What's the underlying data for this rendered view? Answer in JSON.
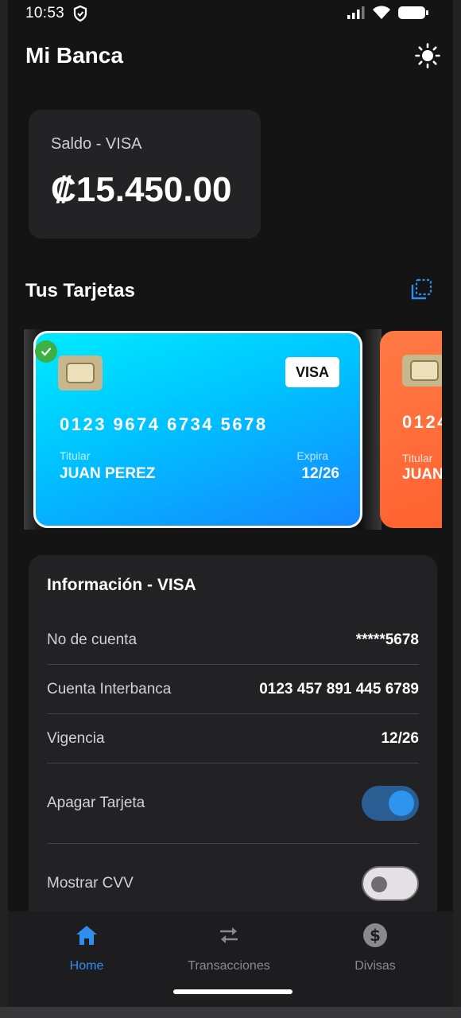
{
  "status_bar": {
    "time": "10:53"
  },
  "app_bar": {
    "title": "Mi Banca"
  },
  "balance": {
    "label": "Saldo - VISA",
    "amount": "₡15.450.00"
  },
  "cards_section": {
    "title": "Tus Tarjetas"
  },
  "cards": [
    {
      "brand": "VISA",
      "number": "0123 9674 6734 5678",
      "holder_label": "Titular",
      "holder": "JUAN PEREZ",
      "expiry_label": "Expira",
      "expiry": "12/26",
      "selected": true,
      "gradient": [
        "#00eaff",
        "#1585ff"
      ]
    },
    {
      "number": "0124",
      "holder_label": "Titular",
      "holder": "JUAN",
      "gradient": [
        "#ff7a45",
        "#ff5f2e"
      ]
    }
  ],
  "info": {
    "title": "Información - VISA",
    "rows": [
      {
        "label": "No de cuenta",
        "value": "*****5678"
      },
      {
        "label": "Cuenta Interbanca",
        "value": "0123 457 891 445 6789"
      },
      {
        "label": "Vigencia",
        "value": "12/26"
      }
    ],
    "toggles": [
      {
        "label": "Apagar Tarjeta",
        "on": true
      },
      {
        "label": "Mostrar CVV",
        "on": false
      }
    ]
  },
  "bottom_nav": [
    {
      "label": "Home",
      "icon": "home-icon",
      "active": true
    },
    {
      "label": "Transacciones",
      "icon": "swap-arrows-icon",
      "active": false
    },
    {
      "label": "Divisas",
      "icon": "dollar-icon",
      "active": false
    }
  ],
  "colors": {
    "accent": "#2f8ff0",
    "background": "#141414",
    "panel": "#222224"
  }
}
